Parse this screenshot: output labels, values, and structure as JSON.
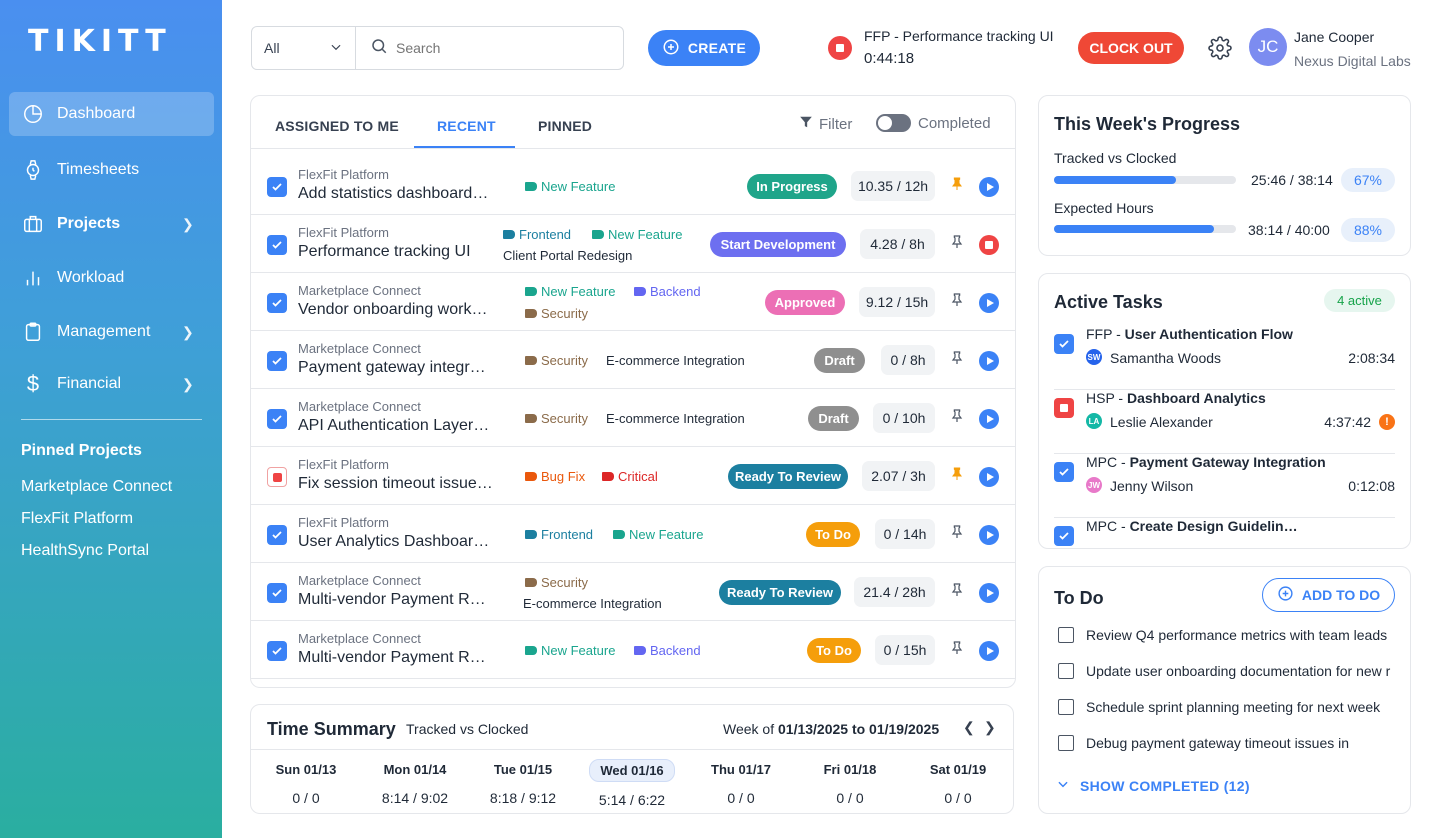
{
  "brand": {
    "logo": "TIKITT"
  },
  "sidebar": {
    "items": [
      {
        "label": "Dashboard",
        "icon": "pie-chart-icon",
        "active": true
      },
      {
        "label": "Timesheets",
        "icon": "watch-icon"
      },
      {
        "label": "Projects",
        "icon": "briefcase-icon",
        "bold": true
      },
      {
        "label": "Workload",
        "icon": "bar-chart-icon"
      },
      {
        "label": "Management",
        "icon": "clipboard-icon"
      },
      {
        "label": "Financial",
        "icon": "dollar-icon"
      }
    ],
    "pinned_title": "Pinned Projects",
    "pinned": [
      "Marketplace Connect",
      "FlexFit Platform",
      "HealthSync Portal"
    ]
  },
  "topbar": {
    "filter_value": "All",
    "search_placeholder": "Search",
    "create_label": "CREATE",
    "timer_task": "FFP - Performance tracking UI",
    "timer_time": "0:44:18",
    "clock_out_label": "CLOCK OUT",
    "user_initials": "JC",
    "user_name": "Jane Cooper",
    "user_org": "Nexus Digital Labs"
  },
  "tasks_panel": {
    "tabs": [
      "ASSIGNED TO ME",
      "RECENT",
      "PINNED"
    ],
    "active_tab": "RECENT",
    "filter_label": "Filter",
    "completed_label": "Completed",
    "rows": [
      {
        "project": "FlexFit Platform",
        "name": "Add statistics dashboard…",
        "status": "In Progress",
        "hours": "10.35 / 12h"
      },
      {
        "project": "FlexFit Platform",
        "name": "Performance tracking UI",
        "extra": "Client Portal Redesign",
        "status": "Start Development",
        "hours": "4.28 / 8h"
      },
      {
        "project": "Marketplace Connect",
        "name": "Vendor onboarding work…",
        "status": "Approved",
        "hours": "9.12 / 15h"
      },
      {
        "project": "Marketplace Connect",
        "name": "Payment gateway integr…",
        "extra": "E-commerce Integration",
        "status": "Draft",
        "hours": "0 / 8h"
      },
      {
        "project": "Marketplace Connect",
        "name": "API Authentication Layer…",
        "extra": "E-commerce Integration",
        "status": "Draft",
        "hours": "0 / 10h"
      },
      {
        "project": "FlexFit Platform",
        "name": "Fix session timeout issue…",
        "status": "Ready To Review",
        "hours": "2.07 / 3h"
      },
      {
        "project": "FlexFit Platform",
        "name": "User Analytics Dashboar…",
        "status": "To Do",
        "hours": "0 / 14h"
      },
      {
        "project": "Marketplace Connect",
        "name": "Multi-vendor Payment R…",
        "extra": "E-commerce Integration",
        "status": "Ready To Review",
        "hours": "21.4 / 28h"
      },
      {
        "project": "Marketplace Connect",
        "name": "Multi-vendor Payment R…",
        "status": "To Do",
        "hours": "0 / 15h"
      }
    ],
    "tags": {
      "new_feature": "New Feature",
      "frontend": "Frontend",
      "backend": "Backend",
      "security": "Security",
      "bug_fix": "Bug Fix",
      "critical": "Critical"
    },
    "colors": {
      "in_progress": "#1fa58a",
      "start_development": "#6d6ff0",
      "approved": "#ec6fb5",
      "draft": "#8f8f8f",
      "ready_to_review": "#1c7fa0",
      "to_do": "#f59e0b",
      "new_feature": "#1aa58e",
      "frontend": "#1c7fa0",
      "backend": "#6366f1",
      "security": "#8b6b4a",
      "bug_fix": "#ea580c",
      "critical": "#dc2626"
    }
  },
  "time_summary": {
    "title": "Time Summary",
    "subtitle": "Tracked vs Clocked",
    "week_prefix": "Week of ",
    "week_range": "01/13/2025 to 01/19/2025",
    "days": [
      {
        "day": "Sun 01/13",
        "value": "0 / 0"
      },
      {
        "day": "Mon 01/14",
        "value": "8:14 / 9:02"
      },
      {
        "day": "Tue 01/15",
        "value": "8:18 / 9:12"
      },
      {
        "day": "Wed 01/16",
        "value": "5:14 / 6:22"
      },
      {
        "day": "Thu 01/17",
        "value": "0 / 0"
      },
      {
        "day": "Fri 01/18",
        "value": "0 / 0"
      },
      {
        "day": "Sat 01/19",
        "value": "0 / 0"
      }
    ]
  },
  "progress": {
    "title": "This Week's Progress",
    "tracked_label": "Tracked vs Clocked",
    "tracked_value": "25:46 / 38:14",
    "tracked_pct": "67%",
    "tracked_fraction": 0.67,
    "expected_label": "Expected Hours",
    "expected_value": "38:14 / 40:00",
    "expected_pct": "88%",
    "expected_fraction": 0.88
  },
  "active_tasks": {
    "title": "Active Tasks",
    "badge": "4 active",
    "items": [
      {
        "code": "FFP - ",
        "name": "User Authentication Flow",
        "initials": "SW",
        "person": "Samantha Woods",
        "duration": "2:08:34",
        "color": "#2563eb"
      },
      {
        "code": "HSP - ",
        "name": "Dashboard Analytics",
        "initials": "LA",
        "person": "Leslie Alexander",
        "duration": "4:37:42",
        "color": "#14b8a6"
      },
      {
        "code": "MPC - ",
        "name": "Payment Gateway Integration",
        "initials": "JW",
        "person": "Jenny Wilson",
        "duration": "0:12:08",
        "color": "#e879c9"
      },
      {
        "code": "MPC - ",
        "name": "Create Design Guidelin…"
      }
    ]
  },
  "todo": {
    "title": "To Do",
    "add_label": "ADD TO DO",
    "items": [
      "Review Q4 performance metrics with team leads",
      "Update user onboarding documentation for new r",
      "Schedule sprint planning meeting for next week",
      "Debug payment gateway timeout issues in"
    ],
    "show_completed": "SHOW COMPLETED (12)"
  }
}
